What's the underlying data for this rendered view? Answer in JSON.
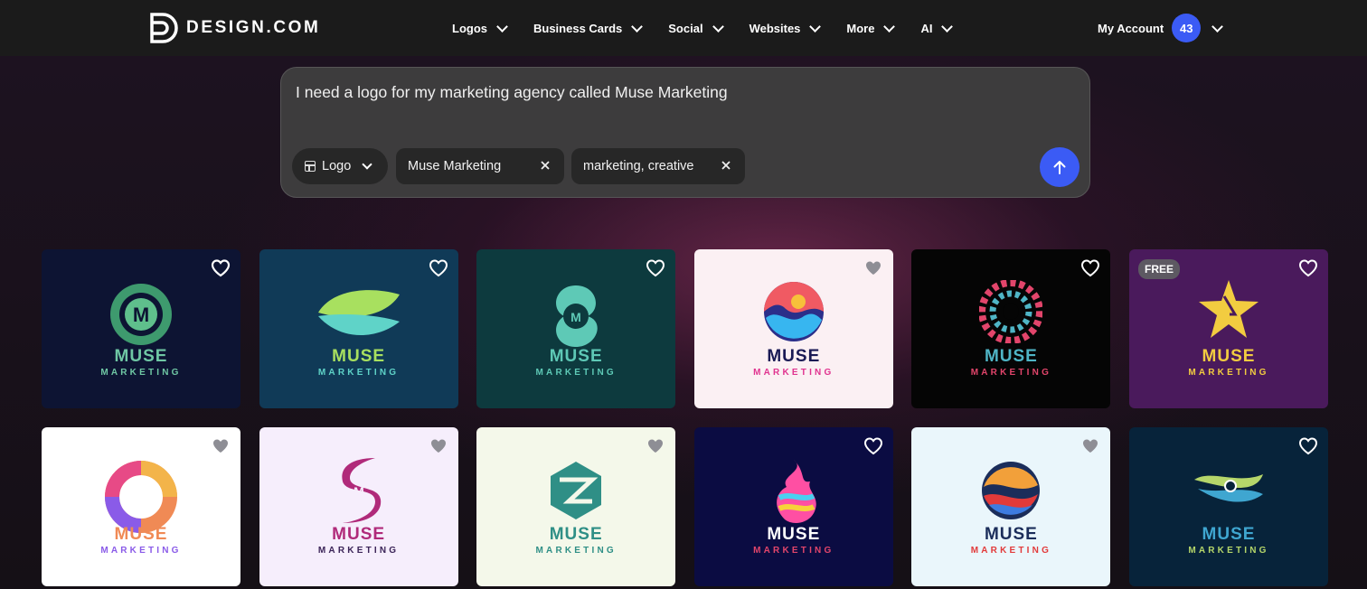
{
  "nav": {
    "brand": "DESIGN.COM",
    "menu": [
      "Logos",
      "Business Cards",
      "Social",
      "Websites",
      "More",
      "AI"
    ],
    "account_label": "My Account",
    "account_badge": "43"
  },
  "search": {
    "prompt": "I need a logo for my marketing agency called Muse Marketing",
    "type_chip": "Logo",
    "name_chip": "Muse Marketing",
    "tags_chip": "marketing, creative"
  },
  "cards": [
    {
      "bg": "#0d1433",
      "w1": "MUSE",
      "w2": "MARKETING",
      "w1c": "#6fc7a4",
      "w2c": "#6fc7a4",
      "fav": "filled",
      "icon": "circle-m-icon",
      "badge": ""
    },
    {
      "bg": "#103a57",
      "w1": "MUSE",
      "w2": "MARKETING",
      "w1c": "#a8e05f",
      "w2c": "#5fd3c8",
      "fav": "outline",
      "icon": "leaf-icon",
      "badge": ""
    },
    {
      "bg": "#0d3a3e",
      "w1": "MUSE",
      "w2": "MARKETING",
      "w1c": "#5ec9b6",
      "w2c": "#5ec9b6",
      "fav": "outline",
      "icon": "swirl-m-icon",
      "badge": ""
    },
    {
      "bg": "#fbf0f3",
      "w1": "MUSE",
      "w2": "MARKETING",
      "w1c": "#1a1a55",
      "w2c": "#e0338f",
      "fav": "gray",
      "icon": "wave-circle-icon",
      "badge": ""
    },
    {
      "bg": "#050505",
      "w1": "MUSE",
      "w2": "MARKETING",
      "w1c": "#4fb5c6",
      "w2c": "#e2456b",
      "fav": "outline",
      "icon": "vortex-icon",
      "badge": ""
    },
    {
      "bg": "#4a1a5c",
      "w1": "MUSE",
      "w2": "MARKETING",
      "w1c": "#f2cc40",
      "w2c": "#f2cc40",
      "fav": "outline",
      "icon": "star-icon",
      "badge": "FREE"
    },
    {
      "bg": "#ffffff",
      "w1": "MUSE",
      "w2": "MARKETING",
      "w1c": "#f08a55",
      "w2c": "#8a5be8",
      "fav": "gray",
      "icon": "ring-icon",
      "badge": ""
    },
    {
      "bg": "#f6eefc",
      "w1": "MUSE",
      "w2": "MARKETING",
      "w1c": "#b02a7a",
      "w2c": "#3b2458",
      "fav": "gray",
      "icon": "s-m-icon",
      "badge": ""
    },
    {
      "bg": "#f4f8ea",
      "w1": "MUSE",
      "w2": "MARKETING",
      "w1c": "#2f8f86",
      "w2c": "#2f8f86",
      "fav": "gray",
      "icon": "hexagon-icon",
      "badge": ""
    },
    {
      "bg": "#0b0c42",
      "w1": "MUSE",
      "w2": "MARKETING",
      "w1c": "#ffffff",
      "w2c": "#e2456b",
      "fav": "outline",
      "icon": "flame-icon",
      "badge": ""
    },
    {
      "bg": "#eaf6fb",
      "w1": "MUSE",
      "w2": "MARKETING",
      "w1c": "#1b2d5a",
      "w2c": "#e23a3a",
      "fav": "gray",
      "icon": "swirl-circle-icon",
      "badge": ""
    },
    {
      "bg": "#07233a",
      "w1": "MUSE",
      "w2": "MARKETING",
      "w1c": "#3fa6d0",
      "w2c": "#b5d66a",
      "fav": "outline",
      "icon": "orbit-icon",
      "badge": ""
    }
  ]
}
